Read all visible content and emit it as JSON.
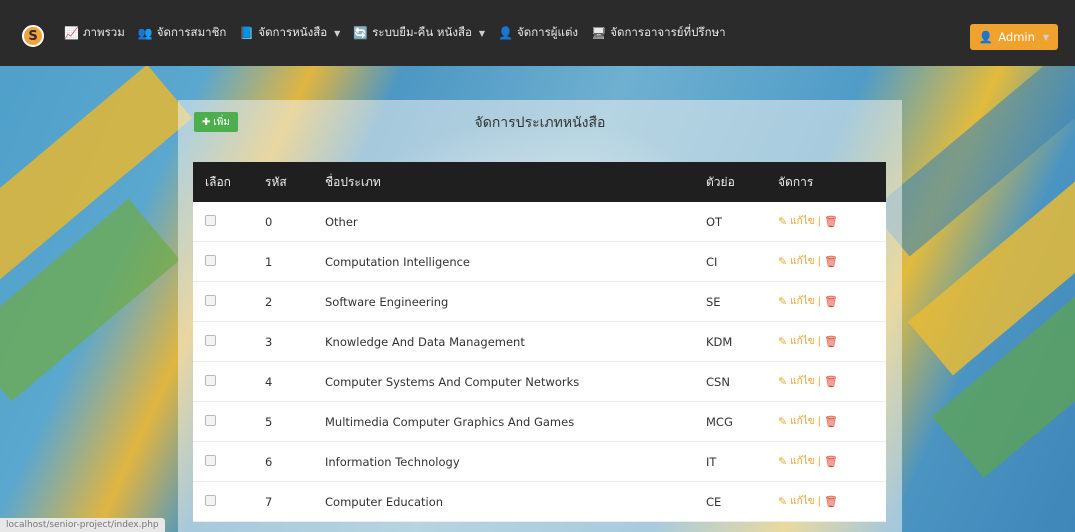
{
  "navbar": {
    "brand_letter": "S",
    "items": [
      {
        "icon": "chart-icon",
        "glyph": "📈",
        "label": "ภาพรวม",
        "dropdown": false
      },
      {
        "icon": "users-icon",
        "glyph": "👥",
        "label": "จัดการสมาชิก",
        "dropdown": false
      },
      {
        "icon": "book-icon",
        "glyph": "📘",
        "label": "จัดการหนังสือ",
        "dropdown": true
      },
      {
        "icon": "exchange-icon",
        "glyph": "🔄",
        "label": "ระบบยืม-คืน หนังสือ",
        "dropdown": true
      },
      {
        "icon": "author-icon",
        "glyph": "👤",
        "label": "จัดการผู้แต่ง",
        "dropdown": false
      },
      {
        "icon": "advisor-icon",
        "glyph": "🖥",
        "label": "จัดการอาจารย์ที่ปรึกษา",
        "dropdown": false
      }
    ],
    "admin_label": "Admin"
  },
  "toolbar": {
    "add_label": "เพิ่ม"
  },
  "page_title": "จัดการประเภทหนังสือ",
  "table": {
    "headers": [
      "เลือก",
      "รหัส",
      "ชื่อประเภท",
      "ตัวย่อ",
      "จัดการ"
    ],
    "edit_label": "แก้ไข",
    "rows": [
      {
        "id": "0",
        "name": "Other",
        "abbr": "OT"
      },
      {
        "id": "1",
        "name": "Computation Intelligence",
        "abbr": "CI"
      },
      {
        "id": "2",
        "name": "Software Engineering",
        "abbr": "SE"
      },
      {
        "id": "3",
        "name": "Knowledge And Data Management",
        "abbr": "KDM"
      },
      {
        "id": "4",
        "name": "Computer Systems And Computer Networks",
        "abbr": "CSN"
      },
      {
        "id": "5",
        "name": "Multimedia Computer Graphics And Games",
        "abbr": "MCG"
      },
      {
        "id": "6",
        "name": "Information Technology",
        "abbr": "IT"
      },
      {
        "id": "7",
        "name": "Computer Education",
        "abbr": "CE"
      }
    ]
  },
  "status_bar": "localhost/senior-project/index.php",
  "colors": {
    "navbar": "#2b2b2b",
    "accent": "#f0a22e",
    "add_button": "#4cae4c",
    "delete": "#d9412f"
  }
}
